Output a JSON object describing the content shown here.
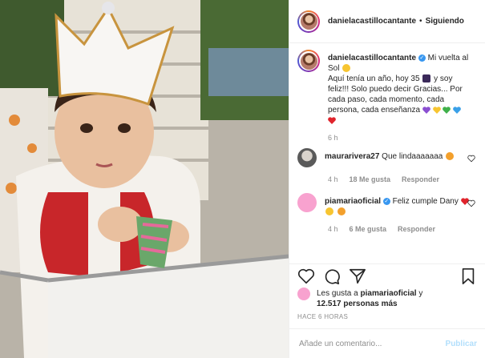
{
  "header": {
    "username": "danielacastillocantante",
    "separator": "•",
    "follow_label": "Siguiendo"
  },
  "caption": {
    "username": "danielacastillocantante",
    "text_1": "Mi vuelta al Sol",
    "text_2": "Aquí tenía un año, hoy 35",
    "text_3": "y soy feliz!!! Solo puedo decir Gracias... Por cada paso, cada momento, cada persona, cada enseñanza",
    "time": "6 h"
  },
  "comments": [
    {
      "username": "maurarivera27",
      "text": "Que lindaaaaaaa",
      "time": "4 h",
      "likes": "18 Me gusta",
      "reply": "Responder"
    },
    {
      "username": "piamariaoficial",
      "text_1": "Feliz cumple Dany",
      "time": "4 h",
      "likes": "6 Me gusta",
      "reply": "Responder"
    }
  ],
  "likes_summary": {
    "prefix": "Les gusta a",
    "user": "piamariaoficial",
    "mid": "y",
    "count": "12.517 personas más"
  },
  "posted_ago": "HACE 6 HORAS",
  "add_comment": {
    "placeholder": "Añade un comentario...",
    "publish_label": "Publicar"
  },
  "colors": {
    "link_blue": "#3897f0",
    "publish_disabled": "#b2dffc",
    "muted": "#8e8e8e"
  },
  "icons": [
    "heart-icon",
    "comment-icon",
    "share-icon",
    "bookmark-icon",
    "verified-icon"
  ]
}
